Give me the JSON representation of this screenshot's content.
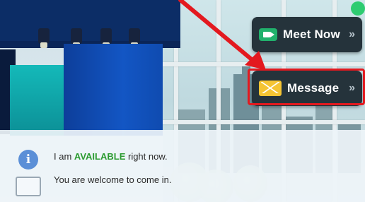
{
  "buttons": {
    "meet_now": {
      "label": "Meet Now",
      "chevron": "»",
      "icon": "video-camera-icon",
      "icon_color": "#21b16c"
    },
    "message": {
      "label": "Message",
      "chevron": "»",
      "icon": "envelope-icon",
      "icon_color": "#f5c433"
    }
  },
  "highlight": {
    "color": "#e3191f"
  },
  "presence": {
    "color": "#2ecc71",
    "status_color": "#2c9b31"
  },
  "info": {
    "icon": "info-icon",
    "line1_prefix": "I am ",
    "status": "AVAILABLE",
    "line1_suffix": " right now.",
    "line2": "You are welcome to come in."
  }
}
